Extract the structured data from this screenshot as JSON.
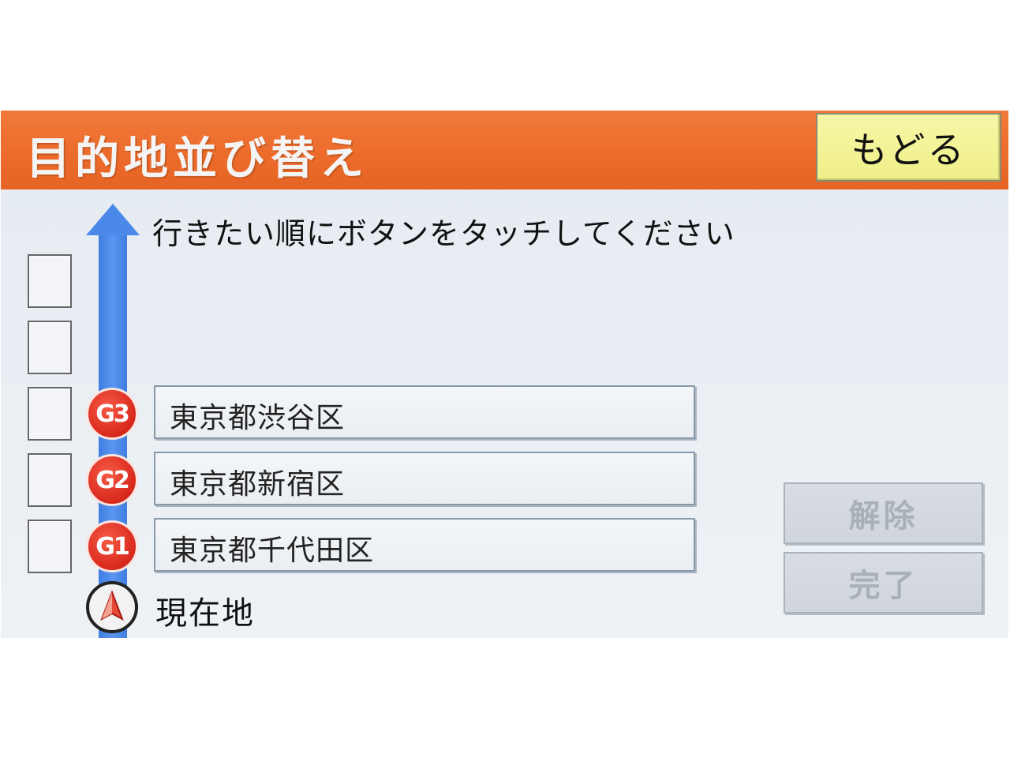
{
  "header": {
    "title": "目的地並び替え",
    "back_label": "もどる"
  },
  "instruction": "行きたい順にボタンをタッチしてください",
  "destinations": [
    {
      "badge": "G3",
      "name": "東京都渋谷区"
    },
    {
      "badge": "G2",
      "name": "東京都新宿区"
    },
    {
      "badge": "G1",
      "name": "東京都千代田区"
    }
  ],
  "current_location": {
    "label": "現在地",
    "icon": "current-location-arrow-icon"
  },
  "actions": {
    "clear_label": "解除",
    "done_label": "完了"
  },
  "colors": {
    "header": "#ec6a2a",
    "back_button": "#efef88",
    "route_line": "#4a88ea",
    "badge": "#d8281c"
  }
}
